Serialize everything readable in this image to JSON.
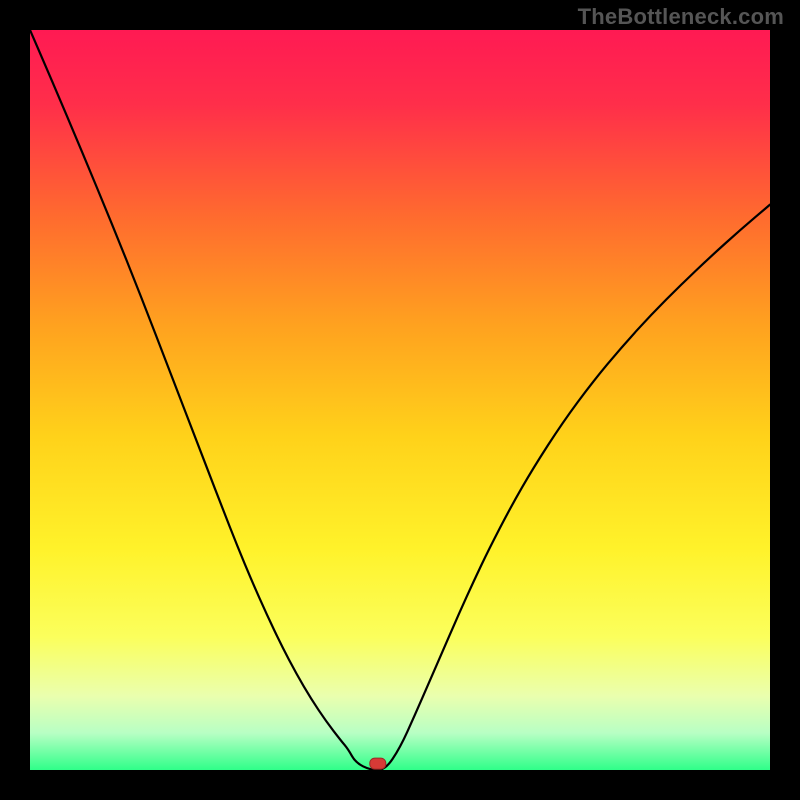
{
  "watermark": "TheBottleneck.com",
  "colors": {
    "frame": "#000000",
    "gradient_stops": [
      {
        "offset": 0.0,
        "color": "#ff1a53"
      },
      {
        "offset": 0.1,
        "color": "#ff2e4a"
      },
      {
        "offset": 0.25,
        "color": "#ff6a2f"
      },
      {
        "offset": 0.4,
        "color": "#ffa21f"
      },
      {
        "offset": 0.55,
        "color": "#ffd21a"
      },
      {
        "offset": 0.7,
        "color": "#fff22a"
      },
      {
        "offset": 0.82,
        "color": "#fbff5c"
      },
      {
        "offset": 0.9,
        "color": "#eaffae"
      },
      {
        "offset": 0.95,
        "color": "#b8ffc4"
      },
      {
        "offset": 1.0,
        "color": "#2fff89"
      }
    ],
    "marker": "#d73a36",
    "curve": "#000000"
  },
  "chart_data": {
    "type": "line",
    "title": "",
    "xlabel": "",
    "ylabel": "",
    "xlim": [
      0,
      100
    ],
    "ylim": [
      0,
      100
    ],
    "grid": false,
    "legend": false,
    "x": [
      0,
      2,
      4,
      6,
      8,
      10,
      12,
      14,
      16,
      18,
      20,
      22,
      24,
      26,
      28,
      30,
      32,
      34,
      36,
      38,
      40,
      42,
      43,
      44,
      46,
      48,
      50,
      52,
      54,
      56,
      58,
      60,
      62,
      65,
      68,
      72,
      76,
      80,
      84,
      88,
      92,
      96,
      100
    ],
    "values": [
      100,
      95.4,
      90.7,
      86.0,
      81.2,
      76.4,
      71.5,
      66.5,
      61.4,
      56.2,
      51.0,
      45.8,
      40.6,
      35.4,
      30.3,
      25.5,
      21.0,
      16.8,
      13.0,
      9.6,
      6.6,
      4.0,
      2.8,
      1.0,
      0.0,
      0.0,
      3.0,
      7.4,
      12.0,
      16.6,
      21.2,
      25.6,
      29.8,
      35.6,
      40.8,
      47.0,
      52.4,
      57.2,
      61.6,
      65.6,
      69.4,
      73.0,
      76.4
    ],
    "marker": {
      "x": 47,
      "y": 0.8
    },
    "notes": "V-shaped bottleneck curve on rainbow vertical gradient; minimum near x≈46–48 at y≈0."
  }
}
